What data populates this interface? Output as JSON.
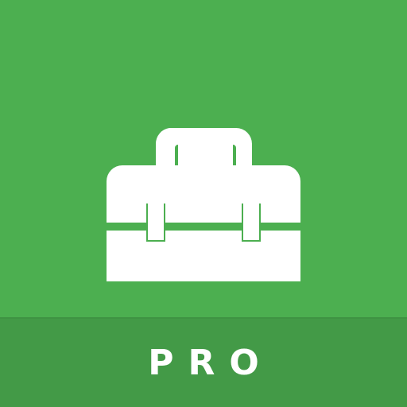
{
  "app_icon": {
    "icon": "toolbox-icon",
    "badge_label": "PRO",
    "colors": {
      "background": "#4caf50",
      "banner": "#439a47",
      "foreground": "#ffffff"
    }
  }
}
